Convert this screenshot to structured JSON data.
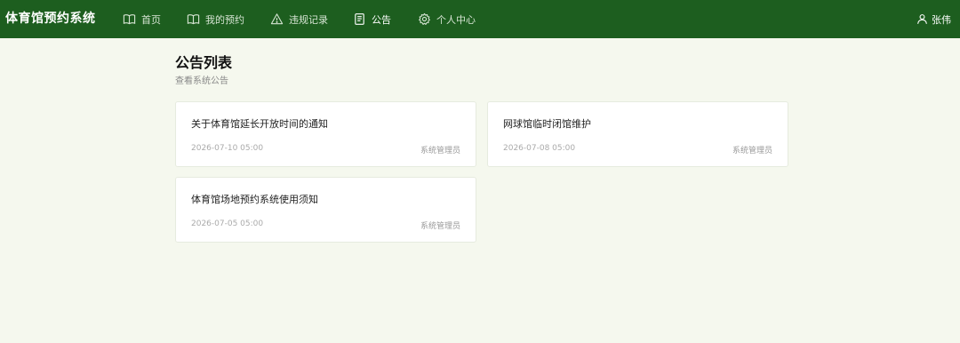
{
  "app": {
    "title": "体育馆预约系统"
  },
  "nav": {
    "items": [
      {
        "label": "首页",
        "icon": "book-open-icon",
        "active": false
      },
      {
        "label": "我的预约",
        "icon": "book-open-icon",
        "active": false
      },
      {
        "label": "违规记录",
        "icon": "warning-icon",
        "active": false
      },
      {
        "label": "公告",
        "icon": "document-icon",
        "active": true
      },
      {
        "label": "个人中心",
        "icon": "gear-icon",
        "active": false
      }
    ]
  },
  "user": {
    "name": "张伟",
    "icon": "user-icon"
  },
  "page": {
    "title": "公告列表",
    "subtitle": "查看系统公告"
  },
  "announcements": [
    {
      "title": "关于体育馆延长开放时间的通知",
      "date": "2026-07-10 05:00",
      "author": "系统管理员"
    },
    {
      "title": "网球馆临时闭馆维护",
      "date": "2026-07-08 05:00",
      "author": "系统管理员"
    },
    {
      "title": "体育馆场地预约系统使用须知",
      "date": "2026-07-05 05:00",
      "author": "系统管理员"
    }
  ],
  "colors": {
    "header_bg": "#1d5e1f",
    "page_bg": "#f5f8ee",
    "card_bg": "#ffffff"
  }
}
